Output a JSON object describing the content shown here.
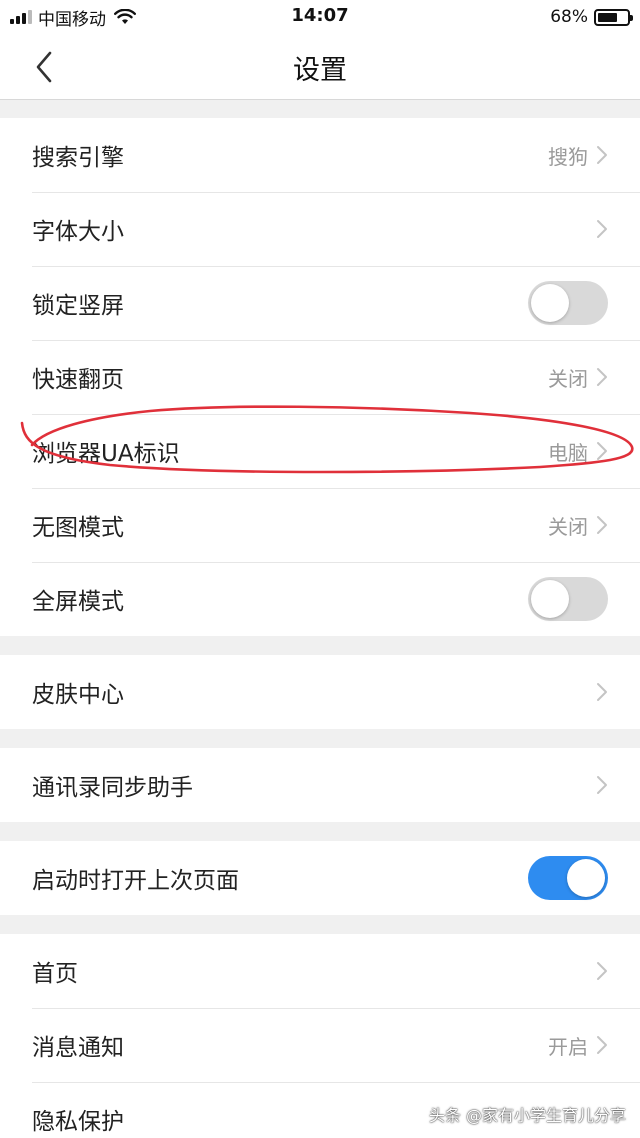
{
  "status_bar": {
    "carrier": "中国移动",
    "time": "14:07",
    "battery_pct": "68%",
    "battery_level": 0.68
  },
  "nav": {
    "title": "设置",
    "back_icon": "chevron-left-icon"
  },
  "section1": {
    "rows": [
      {
        "label": "搜索引擎",
        "value": "搜狗"
      },
      {
        "label": "字体大小",
        "value": ""
      },
      {
        "label": "锁定竖屏",
        "toggle": false
      },
      {
        "label": "快速翻页",
        "value": "关闭"
      },
      {
        "label": "浏览器UA标识",
        "value": "电脑"
      },
      {
        "label": "无图模式",
        "value": "关闭"
      },
      {
        "label": "全屏模式",
        "toggle": false
      }
    ]
  },
  "section2": {
    "rows": [
      {
        "label": "皮肤中心"
      }
    ]
  },
  "section3": {
    "rows": [
      {
        "label": "通讯录同步助手"
      }
    ]
  },
  "section4": {
    "rows": [
      {
        "label": "启动时打开上次页面",
        "toggle": true
      }
    ]
  },
  "section5": {
    "rows": [
      {
        "label": "首页"
      },
      {
        "label": "消息通知",
        "value": "开启"
      },
      {
        "label": "隐私保护"
      }
    ]
  },
  "watermark": "头条 @家有小学生育儿分享",
  "colors": {
    "toggle_on": "#2e8cf0",
    "toggle_off": "#d9d9d9",
    "annotation": "#e0303a",
    "section_gap": "#f0f0f0"
  }
}
